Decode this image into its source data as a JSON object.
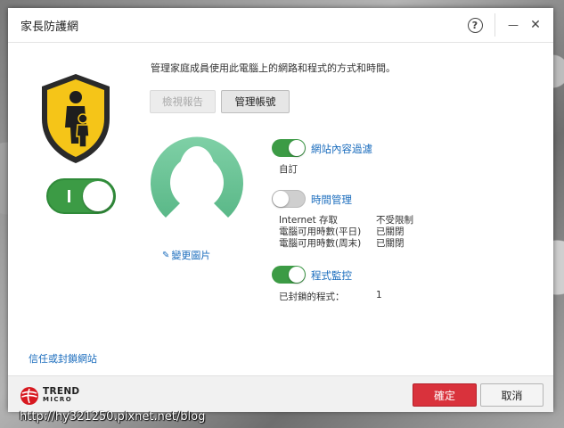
{
  "window": {
    "title": "家長防護網",
    "help_label": "?",
    "minimize_label": "—",
    "close_label": "✕"
  },
  "intro_text": "管理家庭成員使用此電腦上的網路和程式的方式和時間。",
  "buttons": {
    "view_report": "檢視報告",
    "manage_account": "管理帳號",
    "ok": "確定",
    "cancel": "取消"
  },
  "main_toggle": {
    "state": "on",
    "label": "I"
  },
  "change_picture": "變更圖片",
  "features": {
    "web_filter": {
      "label": "網站內容過濾",
      "state": "on",
      "detail": "自訂"
    },
    "time_management": {
      "label": "時間管理",
      "state": "off",
      "rows": [
        {
          "name": "Internet 存取",
          "value": "不受限制"
        },
        {
          "name": "電腦可用時數(平日)",
          "value": "已關閉"
        },
        {
          "name": "電腦可用時數(周末)",
          "value": "已關閉"
        }
      ]
    },
    "program_control": {
      "label": "程式監控",
      "state": "on",
      "blocked_label": "已封鎖的程式：",
      "blocked_count": "1"
    }
  },
  "trust_block_link": "信任或封鎖網站",
  "brand": {
    "line1": "TREND",
    "line2": "MICRO",
    "color": "#d71920"
  },
  "colors": {
    "accent_green": "#3c9b45",
    "link_blue": "#1a6cbd",
    "ok_red": "#d9323c"
  },
  "watermark": "http://hy321250.pixnet.net/blog"
}
